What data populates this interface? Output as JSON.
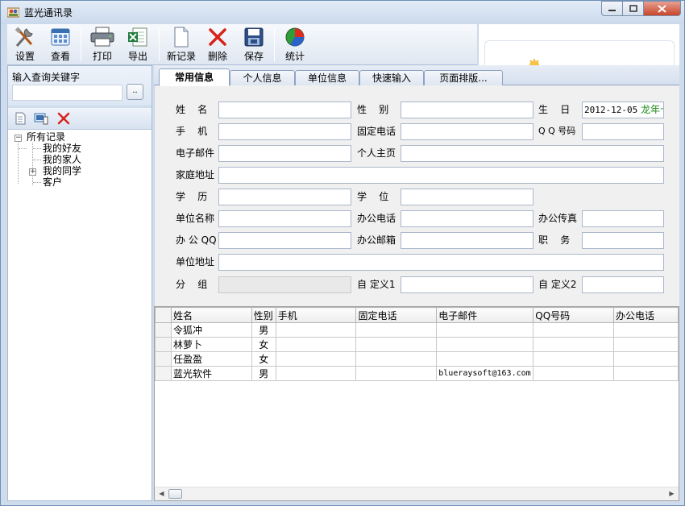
{
  "window": {
    "title": "蓝光通讯录"
  },
  "toolbar": {
    "buttons": [
      {
        "label": "设置",
        "icon": "tools-icon"
      },
      {
        "label": "查看",
        "icon": "view-grid-icon"
      },
      {
        "label": "打印",
        "icon": "printer-icon"
      },
      {
        "label": "导出",
        "icon": "excel-export-icon"
      },
      {
        "label": "新记录",
        "icon": "new-document-icon"
      },
      {
        "label": "删除",
        "icon": "delete-x-icon"
      },
      {
        "label": "保存",
        "icon": "save-disk-icon"
      },
      {
        "label": "统计",
        "icon": "pie-chart-icon"
      }
    ]
  },
  "search": {
    "label": "输入查询关键字",
    "value": "",
    "button_label": ".."
  },
  "tree": {
    "root": "所有记录",
    "children": [
      "我的好友",
      "我的家人",
      "我的同学",
      "客户"
    ]
  },
  "tabs": [
    "常用信息",
    "个人信息",
    "单位信息",
    "快速输入",
    "页面排版..."
  ],
  "form": {
    "name_label": "姓    名",
    "gender_label": "性    别",
    "birthday_label": "生    日",
    "birthday_value": "2012-12-05",
    "birthday_lunar": "龙年十",
    "mobile_label": "手    机",
    "phone_label": "固定电话",
    "qq_label": "Q Q 号码",
    "email_label": "电子邮件",
    "homepage_label": "个人主页",
    "address_label": "家庭地址",
    "education_label": "学    历",
    "degree_label": "学    位",
    "company_label": "单位名称",
    "office_phone_label": "办公电话",
    "office_fax_label": "办公传真",
    "office_qq_label": "办 公 QQ",
    "office_email_label": "办公邮箱",
    "position_label": "职    务",
    "company_address_label": "单位地址",
    "group_label": "分    组",
    "custom1_label": "自 定义1",
    "custom2_label": "自 定义2"
  },
  "grid": {
    "columns": [
      "姓名",
      "性别",
      "手机",
      "固定电话",
      "电子邮件",
      "QQ号码",
      "办公电话"
    ],
    "rows": [
      [
        "令狐冲",
        "男",
        "",
        "",
        "",
        "",
        ""
      ],
      [
        "林萝卜",
        "女",
        "",
        "",
        "",
        "",
        ""
      ],
      [
        "任盈盈",
        "女",
        "",
        "",
        "",
        "",
        ""
      ],
      [
        "蓝光软件",
        "男",
        "",
        "",
        "blueraysoft@163.com",
        "",
        ""
      ]
    ]
  },
  "colors": {
    "titlebar": "#cad9ec",
    "tab_border": "#8ea4c2",
    "date_lunar": "#1a8a1a"
  }
}
